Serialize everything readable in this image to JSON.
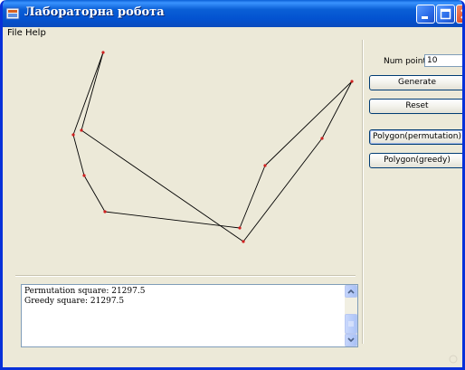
{
  "window": {
    "title": "Лабораторна робота",
    "controls": [
      "minimize-icon",
      "maximize-icon",
      "close-icon"
    ],
    "colors": {
      "titlebar": "#0a5fd6",
      "face": "#ece9d8",
      "close": "#e0502a"
    }
  },
  "menu": [
    {
      "label": "File"
    },
    {
      "label": "Help"
    }
  ],
  "controls": {
    "num_points_label": "Num points",
    "num_points_value": "10",
    "generate_label": "Generate",
    "reset_label": "Reset",
    "polygon_permutation_label": "Polygon(permutation)",
    "polygon_greedy_label": "Polygon(greedy)"
  },
  "output": {
    "lines": [
      "Permutation square: 21297.5",
      "Greedy square: 21297.5"
    ]
  },
  "polygon": {
    "vertex_color": "#d02020",
    "edge_color": "#000000"
  }
}
